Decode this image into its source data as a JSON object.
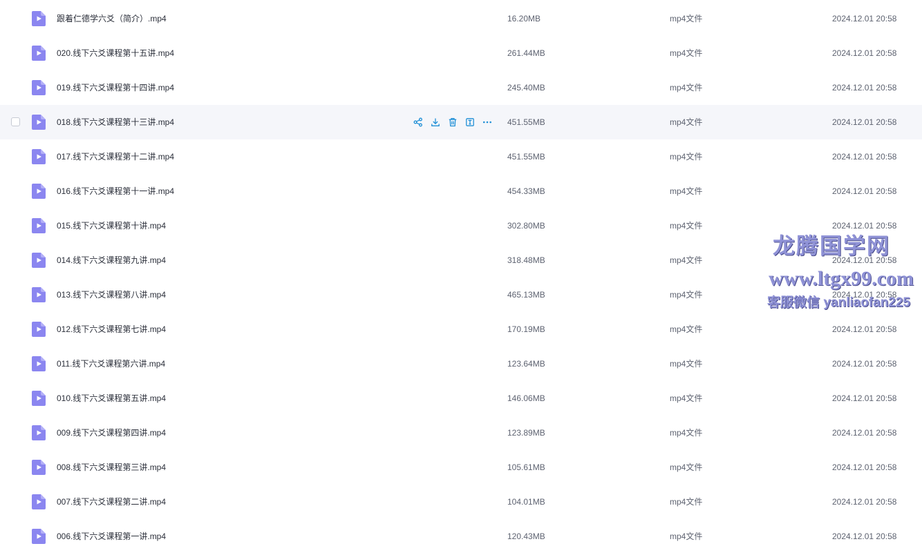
{
  "files": [
    {
      "name": "跟着仁德学六爻（简介）.mp4",
      "size": "16.20MB",
      "type": "mp4文件",
      "date": "2024.12.01 20:58"
    },
    {
      "name": "020.线下六爻课程第十五讲.mp4",
      "size": "261.44MB",
      "type": "mp4文件",
      "date": "2024.12.01 20:58"
    },
    {
      "name": "019.线下六爻课程第十四讲.mp4",
      "size": "245.40MB",
      "type": "mp4文件",
      "date": "2024.12.01 20:58"
    },
    {
      "name": "018.线下六爻课程第十三讲.mp4",
      "size": "451.55MB",
      "type": "mp4文件",
      "date": "2024.12.01 20:58",
      "hovered": true
    },
    {
      "name": "017.线下六爻课程第十二讲.mp4",
      "size": "451.55MB",
      "type": "mp4文件",
      "date": "2024.12.01 20:58"
    },
    {
      "name": "016.线下六爻课程第十一讲.mp4",
      "size": "454.33MB",
      "type": "mp4文件",
      "date": "2024.12.01 20:58"
    },
    {
      "name": "015.线下六爻课程第十讲.mp4",
      "size": "302.80MB",
      "type": "mp4文件",
      "date": "2024.12.01 20:58"
    },
    {
      "name": "014.线下六爻课程第九讲.mp4",
      "size": "318.48MB",
      "type": "mp4文件",
      "date": "2024.12.01 20:58"
    },
    {
      "name": "013.线下六爻课程第八讲.mp4",
      "size": "465.13MB",
      "type": "mp4文件",
      "date": "2024.12.01 20:58"
    },
    {
      "name": "012.线下六爻课程第七讲.mp4",
      "size": "170.19MB",
      "type": "mp4文件",
      "date": "2024.12.01 20:58"
    },
    {
      "name": "011.线下六爻课程第六讲.mp4",
      "size": "123.64MB",
      "type": "mp4文件",
      "date": "2024.12.01 20:58"
    },
    {
      "name": "010.线下六爻课程第五讲.mp4",
      "size": "146.06MB",
      "type": "mp4文件",
      "date": "2024.12.01 20:58"
    },
    {
      "name": "009.线下六爻课程第四讲.mp4",
      "size": "123.89MB",
      "type": "mp4文件",
      "date": "2024.12.01 20:58"
    },
    {
      "name": "008.线下六爻课程第三讲.mp4",
      "size": "105.61MB",
      "type": "mp4文件",
      "date": "2024.12.01 20:58"
    },
    {
      "name": "007.线下六爻课程第二讲.mp4",
      "size": "104.01MB",
      "type": "mp4文件",
      "date": "2024.12.01 20:58"
    },
    {
      "name": "006.线下六爻课程第一讲.mp4",
      "size": "120.43MB",
      "type": "mp4文件",
      "date": "2024.12.01 20:58"
    }
  ],
  "row_actions": [
    "share-icon",
    "download-icon",
    "delete-icon",
    "rename-icon",
    "more-icon"
  ],
  "watermark": {
    "line1": "龙腾国学网",
    "line2": "www.ltgx99.com",
    "line3": "客服微信 yanliaofan225"
  },
  "colors": {
    "file_icon": "#8b86f0",
    "action_icon": "#1f8fd6",
    "hover_row": "#f5f6fa",
    "watermark": "#8f92d6"
  }
}
